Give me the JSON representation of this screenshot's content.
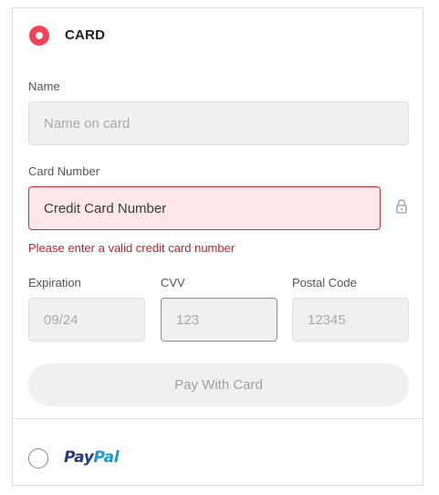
{
  "card": {
    "title": "CARD",
    "name": {
      "label": "Name",
      "placeholder": "Name on card"
    },
    "card_number": {
      "label": "Card Number",
      "placeholder": "Credit Card Number",
      "error": "Please enter a valid credit card number"
    },
    "expiration": {
      "label": "Expiration",
      "placeholder": "09/24"
    },
    "cvv": {
      "label": "CVV",
      "placeholder": "123"
    },
    "postal": {
      "label": "Postal Code",
      "placeholder": "12345"
    },
    "pay_button": "Pay With Card",
    "selected": true
  },
  "paypal": {
    "logo_part1": "Pay",
    "logo_part2": "Pal",
    "selected": false
  },
  "colors": {
    "accent": "#f44254",
    "error": "#c2202f",
    "paypal_dark": "#253b80",
    "paypal_light": "#179bd7"
  },
  "icons": {
    "lock": "lock-icon"
  }
}
